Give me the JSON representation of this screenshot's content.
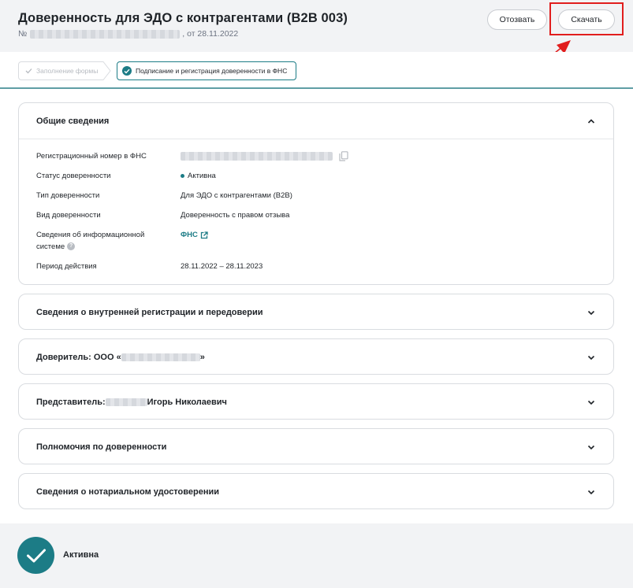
{
  "header": {
    "title": "Доверенность для ЭДО с контрагентами (B2B 003)",
    "number_prefix": "№",
    "date_text": ", от 28.11.2022",
    "revoke_label": "Отозвать",
    "download_label": "Скачать"
  },
  "steps": [
    {
      "label": "Заполнение формы",
      "state": "completed"
    },
    {
      "label": "Подписание и регистрация доверенности в ФНС",
      "state": "active"
    }
  ],
  "general": {
    "title": "Общие сведения",
    "rows": [
      {
        "label": "Регистрационный номер в ФНС",
        "value": ""
      },
      {
        "label": "Статус доверенности",
        "value": "Активна"
      },
      {
        "label": "Тип доверенности",
        "value": "Для ЭДО с контрагентами (B2B)"
      },
      {
        "label": "Вид доверенности",
        "value": "Доверенность с правом отзыва"
      },
      {
        "label": "Сведения об информационной системе",
        "value": "ФНС"
      },
      {
        "label": "Период действия",
        "value": "28.11.2022 – 28.11.2023"
      }
    ]
  },
  "sections": [
    {
      "title": "Сведения о внутренней регистрации и передоверии"
    },
    {
      "title_prefix": "Доверитель: ООО «",
      "title_suffix": "»"
    },
    {
      "title_prefix": "Представитель:",
      "title_suffix": "Игорь Николаевич"
    },
    {
      "title": "Полномочия по доверенности"
    },
    {
      "title": "Сведения о нотариальном удостоверении"
    }
  ],
  "footer": {
    "status": "Активна"
  },
  "colors": {
    "accent": "#1c7c86",
    "highlight": "#e11d1d",
    "header_bg": "#f2f3f5",
    "border": "#d9dce0"
  }
}
